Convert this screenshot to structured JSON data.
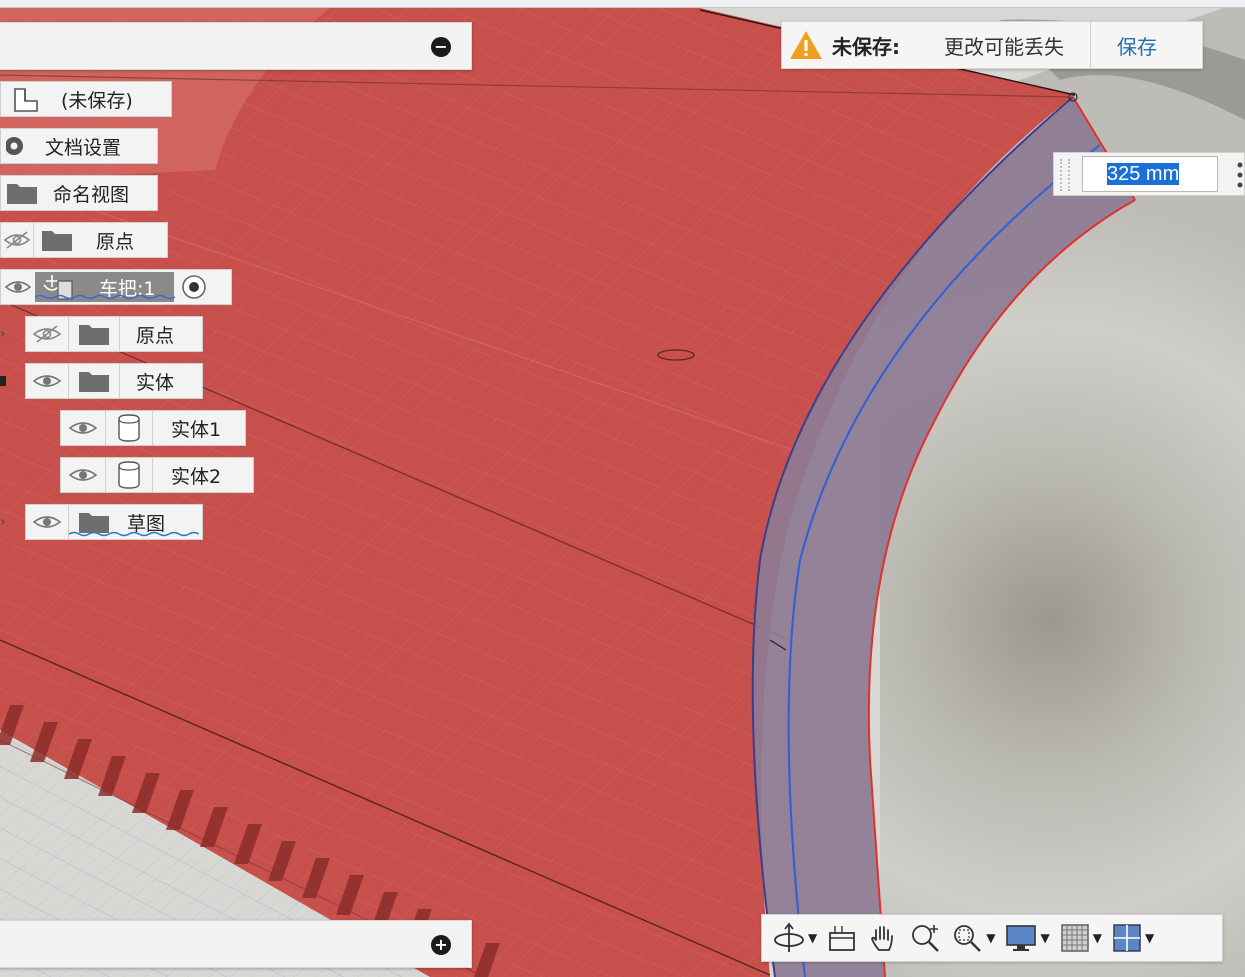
{
  "colors": {
    "body_red": "#c8504c",
    "accent_blue": "#1f6fb5",
    "panel_bg": "#f2f2f2",
    "selection": "#1b6fd6"
  },
  "browser": {
    "document_label": "(未保存)",
    "document_settings": "文档设置",
    "named_views": "命名视图",
    "origin": "原点",
    "component": "车把:1",
    "component_origin": "原点",
    "bodies": "实体",
    "body1": "实体1",
    "body2": "实体2",
    "sketches": "草图"
  },
  "banner": {
    "title": "未保存:",
    "message": "更改可能丢失",
    "save_label": "保存"
  },
  "dimension_input": {
    "value": "325 mm"
  },
  "nav_toolbar": {
    "tools": [
      "orbit-icon",
      "look-at-icon",
      "pan-icon",
      "zoom-icon",
      "fit-icon",
      "display-icon",
      "grid-icon",
      "viewports-icon"
    ]
  }
}
